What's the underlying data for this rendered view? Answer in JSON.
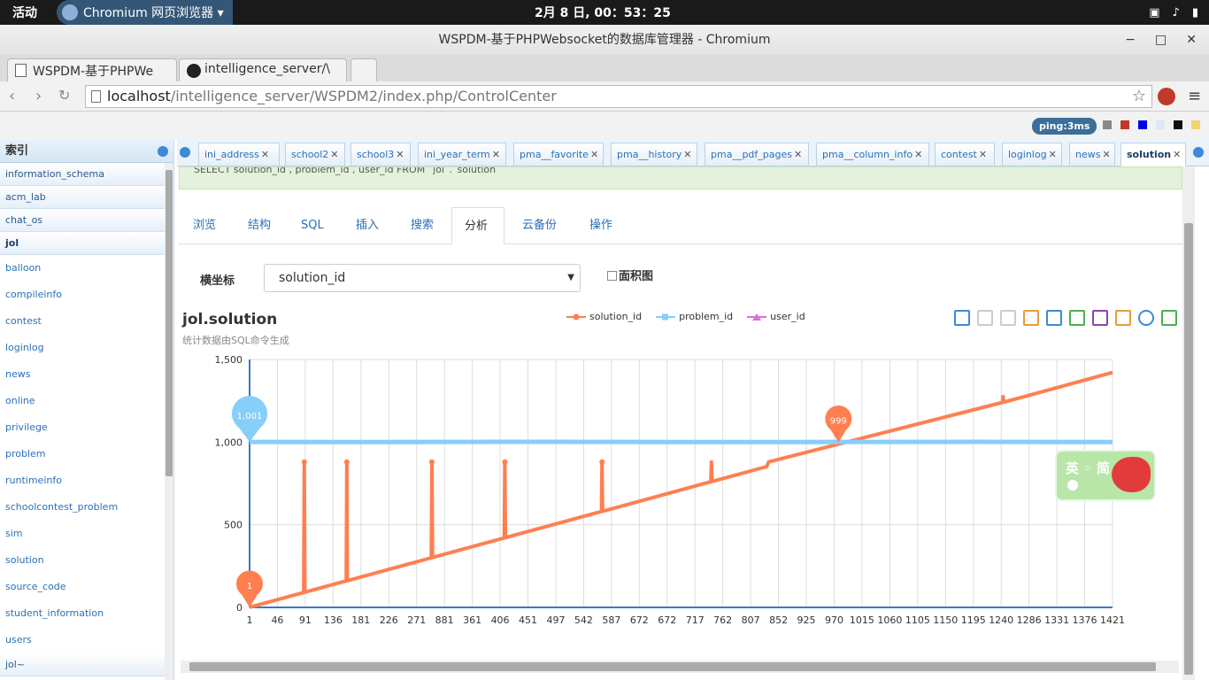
{
  "os": {
    "activities": "活动",
    "app_name": "Chromium 网页浏览器 ▾",
    "clock": "2月  8 日, 00：53：25"
  },
  "window": {
    "title": "WSPDM-基于PHPWebsocket的数据库管理器 - Chromium"
  },
  "browser_tabs": [
    {
      "label": "WSPDM-基于PHPWe"
    },
    {
      "label": "intelligence_server/\\"
    }
  ],
  "url": {
    "host": "localhost",
    "path": "/intelligence_server/WSPDM2/index.php/ControlCenter"
  },
  "ping": "ping:3ms",
  "swatches": [
    "#888888",
    "#c0392b",
    "#0000ee",
    "#dde8f6",
    "#111111",
    "#f3d36e"
  ],
  "sidebar": {
    "header": "索引",
    "databases": [
      {
        "label": "information_schema"
      },
      {
        "label": "acm_lab"
      },
      {
        "label": "chat_os"
      },
      {
        "label": "jol"
      }
    ],
    "tables": [
      {
        "label": "balloon"
      },
      {
        "label": "compileinfo"
      },
      {
        "label": "contest"
      },
      {
        "label": "loginlog"
      },
      {
        "label": "news"
      },
      {
        "label": "online"
      },
      {
        "label": "privilege"
      },
      {
        "label": "problem"
      },
      {
        "label": "runtimeinfo"
      },
      {
        "label": "schoolcontest_problem"
      },
      {
        "label": "sim"
      },
      {
        "label": "solution"
      },
      {
        "label": "source_code"
      },
      {
        "label": "student_information"
      },
      {
        "label": "users"
      }
    ],
    "footer_db": "jol~"
  },
  "table_tabs": [
    {
      "label": "ini_address"
    },
    {
      "label": "school2"
    },
    {
      "label": "school3"
    },
    {
      "label": "ini_year_term"
    },
    {
      "label": "pma__favorite"
    },
    {
      "label": "pma__history"
    },
    {
      "label": "pma__pdf_pages"
    },
    {
      "label": "pma__column_info"
    },
    {
      "label": "contest"
    },
    {
      "label": "loginlog"
    },
    {
      "label": "news"
    },
    {
      "label": "solution"
    }
  ],
  "sql_snippet": "SELECT solution_id , problem_id , user_id FROM `jol`.`solution`",
  "sub_tabs": [
    {
      "label": "浏览"
    },
    {
      "label": "结构"
    },
    {
      "label": "SQL"
    },
    {
      "label": "插入"
    },
    {
      "label": "搜索"
    },
    {
      "label": "分析"
    },
    {
      "label": "云备份"
    },
    {
      "label": "操作"
    }
  ],
  "xaxis_label": "横坐标",
  "xaxis_value": "solution_id",
  "area_label": "面积图",
  "chart_data": {
    "type": "line",
    "title": "jol.solution",
    "subtitle": "统计数据由SQL命令生成",
    "legend_position": "top-center",
    "xlabel": "",
    "ylabel": "",
    "ylim": [
      0,
      1500
    ],
    "yticks": [
      "0",
      "500",
      "1,000",
      "1,500"
    ],
    "x_tick_labels": [
      "1",
      "46",
      "91",
      "136",
      "181",
      "226",
      "271",
      "881",
      "361",
      "406",
      "451",
      "497",
      "542",
      "587",
      "672",
      "672",
      "717",
      "762",
      "807",
      "852",
      "925",
      "970",
      "1015",
      "1060",
      "1105",
      "1150",
      "1195",
      "1240",
      "1286",
      "1331",
      "1376",
      "1421"
    ],
    "n_points": 1421,
    "series": [
      {
        "name": "solution_id",
        "color": "#ff7f50",
        "points": [
          [
            1,
            1
          ],
          [
            90,
            90
          ],
          [
            91,
            880
          ],
          [
            92,
            92
          ],
          [
            160,
            160
          ],
          [
            161,
            880
          ],
          [
            162,
            162
          ],
          [
            300,
            300
          ],
          [
            301,
            880
          ],
          [
            302,
            302
          ],
          [
            420,
            420
          ],
          [
            421,
            880
          ],
          [
            422,
            422
          ],
          [
            580,
            580
          ],
          [
            581,
            880
          ],
          [
            582,
            582
          ],
          [
            760,
            760
          ],
          [
            761,
            880
          ],
          [
            762,
            762
          ],
          [
            852,
            852
          ],
          [
            855,
            880
          ],
          [
            1240,
            1240
          ],
          [
            1241,
            1275
          ],
          [
            1242,
            1242
          ],
          [
            1421,
            1421
          ]
        ]
      },
      {
        "name": "problem_id",
        "color": "#87cefa",
        "points": [
          [
            1,
            1001
          ],
          [
            200,
            1000
          ],
          [
            400,
            1002
          ],
          [
            600,
            1001
          ],
          [
            800,
            1000
          ],
          [
            1000,
            1001
          ],
          [
            1200,
            1002
          ],
          [
            1421,
            1000
          ]
        ]
      },
      {
        "name": "user_id",
        "color": "#da70d6",
        "points": []
      }
    ],
    "markers": [
      {
        "label": "1,001",
        "x": 1,
        "y": 1001,
        "color": "#87cefa"
      },
      {
        "label": "1",
        "x": 1,
        "y": 1,
        "color": "#ff7f50"
      },
      {
        "label": "999",
        "x": 970,
        "y": 999,
        "color": "#ff7f50"
      }
    ]
  },
  "ime": {
    "text": "英 ◦ 简"
  }
}
